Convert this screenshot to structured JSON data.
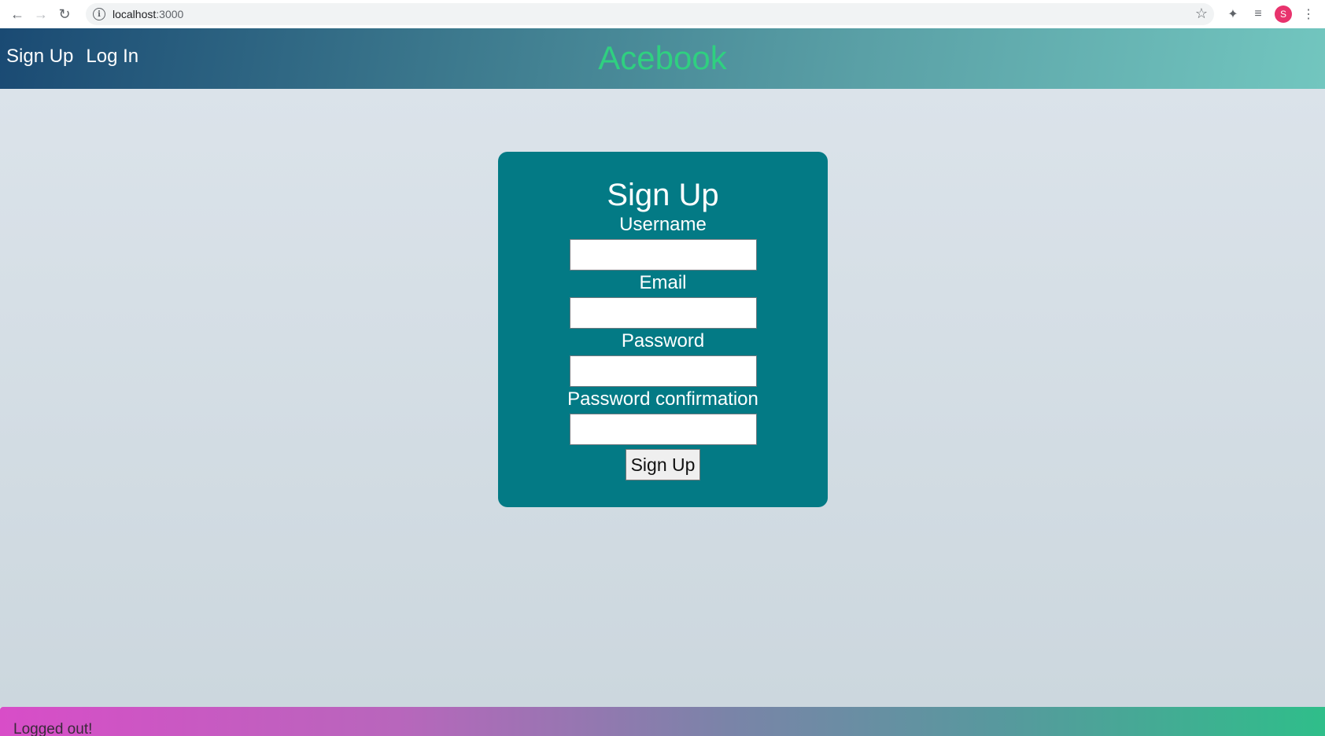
{
  "browser": {
    "url_host": "localhost",
    "url_port": ":3000",
    "avatar_letter": "S",
    "icons": [
      "back-arrow-icon",
      "forward-arrow-icon",
      "reload-icon",
      "info-icon",
      "star-icon",
      "puzzle-icon",
      "media-queue-icon",
      "kebab-menu-icon"
    ]
  },
  "header": {
    "nav": [
      "Sign Up",
      "Log In"
    ],
    "brand": "Acebook"
  },
  "signup_form": {
    "title": "Sign Up",
    "fields": [
      {
        "label": "Username",
        "value": "",
        "placeholder": ""
      },
      {
        "label": "Email",
        "value": "",
        "placeholder": ""
      },
      {
        "label": "Password",
        "value": "",
        "placeholder": ""
      },
      {
        "label": "Password confirmation",
        "value": "",
        "placeholder": ""
      }
    ],
    "submit_label": "Sign Up"
  },
  "flash": {
    "message": "Logged out!"
  },
  "colors": {
    "card": "#037a85",
    "brand": "#2fd080",
    "background": "#d3dde3"
  }
}
